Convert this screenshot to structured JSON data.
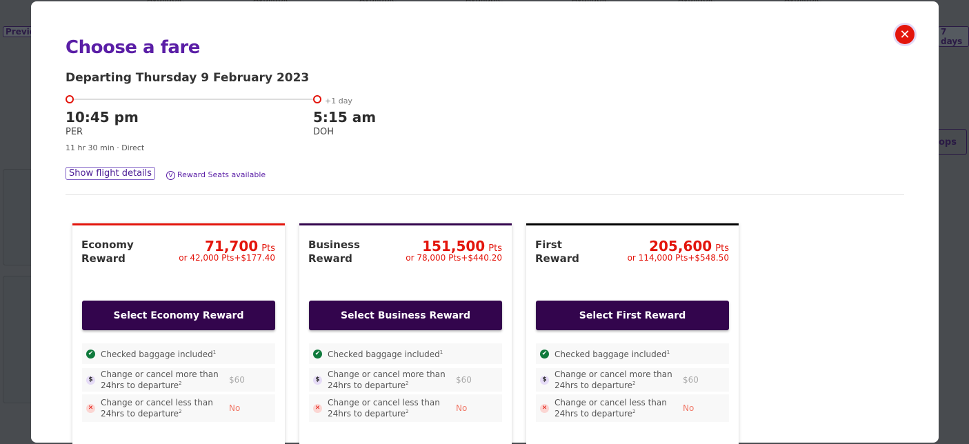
{
  "background": {
    "top_labels": [
      "Available",
      "Available",
      "Available",
      "Available",
      "Available",
      "Available",
      "Available"
    ],
    "previous_label": "Previo",
    "next_label": "7 days",
    "stops_label": "ops"
  },
  "modal": {
    "title": "Choose a fare",
    "departing": "Departing Thursday 9 February 2023",
    "depart_time": "10:45 pm",
    "depart_code": "PER",
    "arrive_time": "5:15 am",
    "arrive_code": "DOH",
    "day_offset": "+1 day",
    "duration": "11 hr 30 min · Direct",
    "show_details": "Show flight details",
    "reward_seats": "Reward Seats available",
    "reward_icon": "V",
    "close_icon": "✕",
    "colors": {
      "accent": "#5a1ea6",
      "price": "#e3150c",
      "button": "#33054d"
    }
  },
  "fares": [
    {
      "name": "Economy Reward",
      "points": "71,700",
      "pts": "Pts",
      "alt": "or 42,000 Pts+$177.40",
      "button": "Select Economy Reward",
      "border": "#e3150c",
      "features": [
        {
          "icon": "check",
          "text": "Checked baggage included",
          "sup": "1",
          "value": ""
        },
        {
          "icon": "dollar",
          "text": "Change or cancel more than 24hrs to departure",
          "sup": "2",
          "value": "$60"
        },
        {
          "icon": "cross",
          "text": "Change or cancel less than 24hrs to departure",
          "sup": "2",
          "value": "No"
        }
      ]
    },
    {
      "name": "Business Reward",
      "points": "151,500",
      "pts": "Pts",
      "alt": "or 78,000 Pts+$440.20",
      "button": "Select Business Reward",
      "border": "#33054d",
      "features": [
        {
          "icon": "check",
          "text": "Checked baggage included",
          "sup": "1",
          "value": ""
        },
        {
          "icon": "dollar",
          "text": "Change or cancel more than 24hrs to departure",
          "sup": "2",
          "value": "$60"
        },
        {
          "icon": "cross",
          "text": "Change or cancel less than 24hrs to departure",
          "sup": "2",
          "value": "No"
        }
      ]
    },
    {
      "name": "First Reward",
      "points": "205,600",
      "pts": "Pts",
      "alt": "or 114,000 Pts+$548.50",
      "button": "Select First Reward",
      "border": "#000000",
      "features": [
        {
          "icon": "check",
          "text": "Checked baggage included",
          "sup": "1",
          "value": ""
        },
        {
          "icon": "dollar",
          "text": "Change or cancel more than 24hrs to departure",
          "sup": "2",
          "value": "$60"
        },
        {
          "icon": "cross",
          "text": "Change or cancel less than 24hrs to departure",
          "sup": "2",
          "value": "No"
        }
      ]
    }
  ]
}
